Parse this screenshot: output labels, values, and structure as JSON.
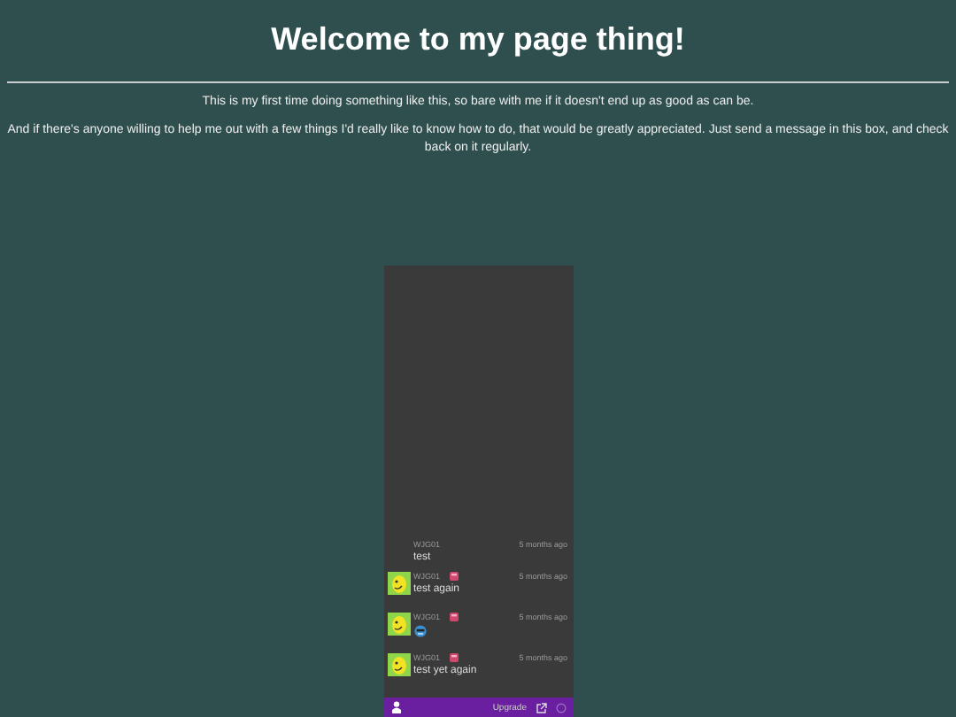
{
  "heading": "Welcome to my page thing!",
  "paragraphs": [
    "This is my first time doing something like this, so bare with me if it doesn't end up as good as can be.",
    "And if there's anyone willing to help me out with a few things I'd really like to know how to do, that would be greatly appreciated. Just send a message in this box, and check back on it regularly."
  ],
  "chat": {
    "messages": [
      {
        "author": "WJG01",
        "time": "5 months ago",
        "avatar": false,
        "kind": "text",
        "text": "test"
      },
      {
        "author": "WJG01",
        "time": "5 months ago",
        "avatar": true,
        "kind": "text",
        "text": "test again"
      },
      {
        "author": "WJG01",
        "time": "5 months ago",
        "avatar": true,
        "kind": "emoji"
      },
      {
        "author": "WJG01",
        "time": "5 months ago",
        "avatar": true,
        "kind": "text",
        "text": "test yet again"
      }
    ],
    "footer": {
      "link": "Upgrade"
    }
  }
}
